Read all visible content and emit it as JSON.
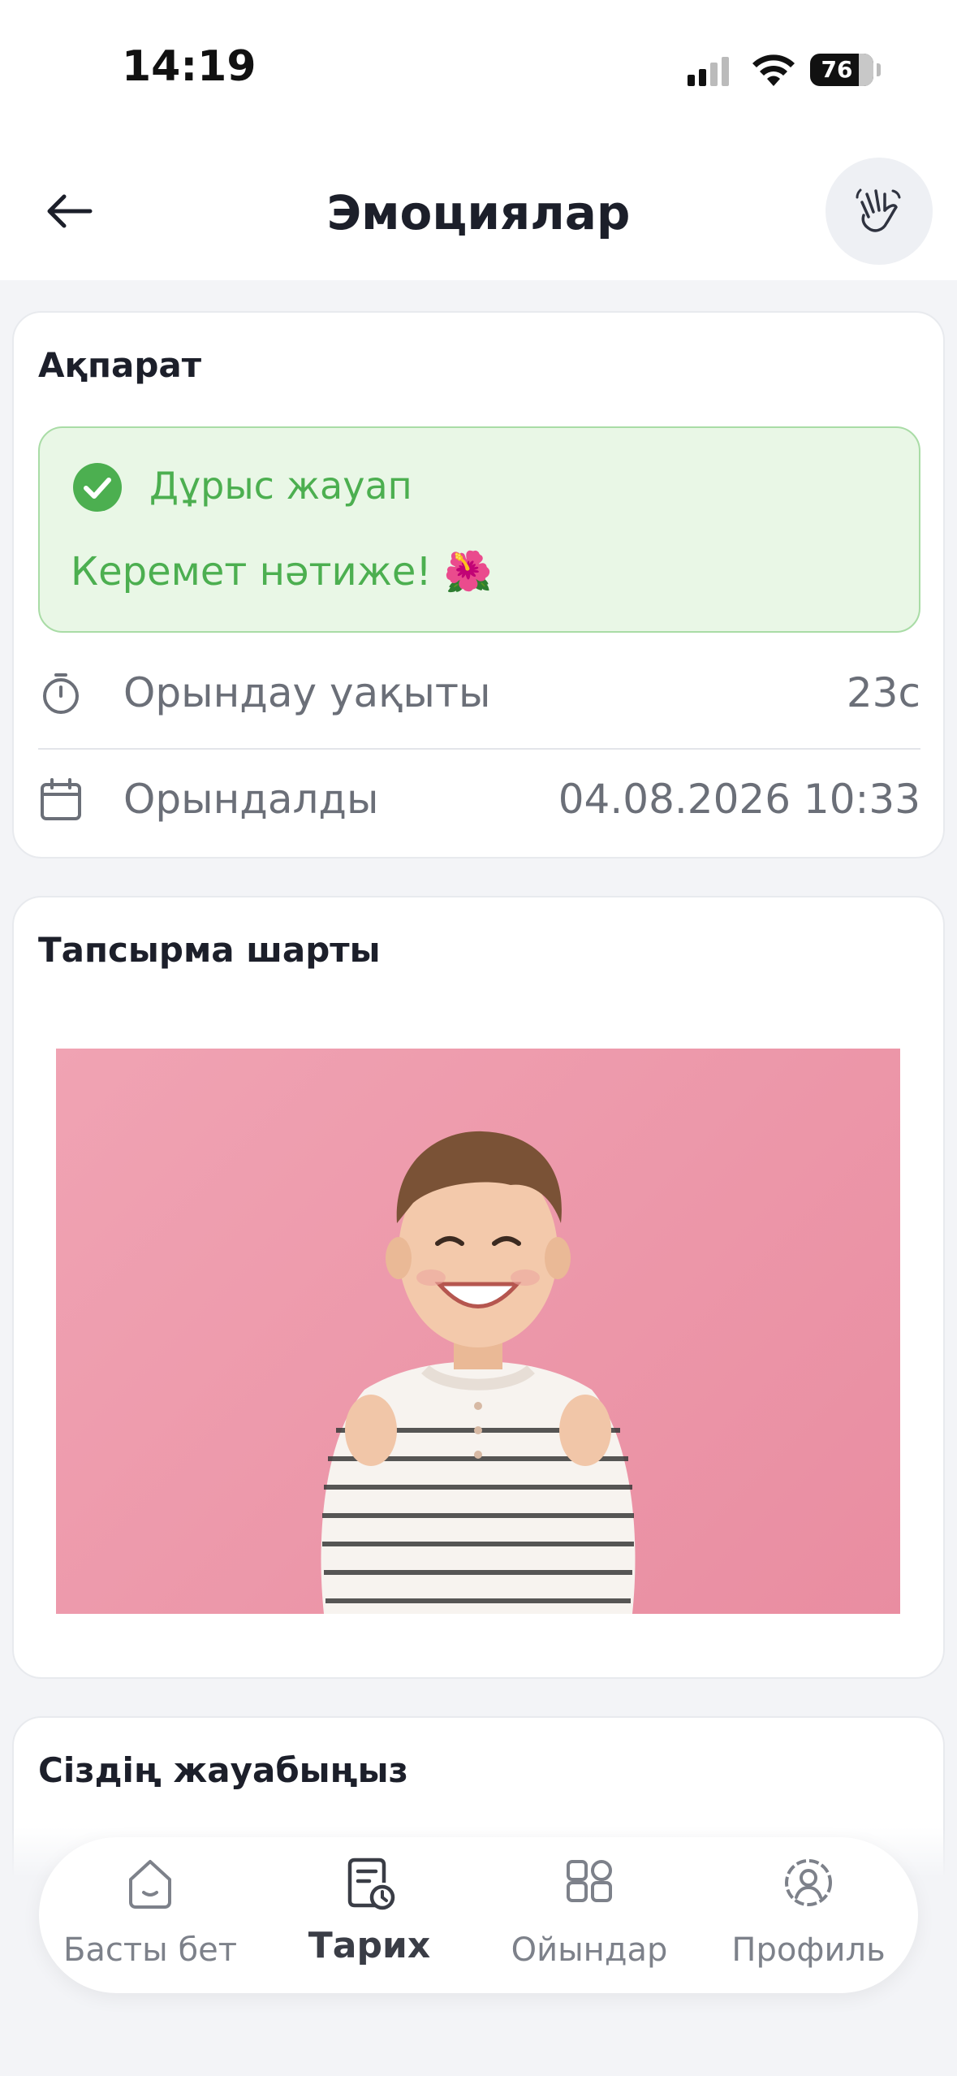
{
  "status_bar": {
    "time": "14:19",
    "battery": "76"
  },
  "header": {
    "title": "Эмоциялар",
    "back_icon": "arrow-left-icon",
    "action_icon": "waving-hand-icon"
  },
  "info_card": {
    "title": "Ақпарат",
    "result": {
      "title": "Дұрыс жауап",
      "message": "Керемет нәтиже! 🌺",
      "color": "#4caf50",
      "background": "#e9f7e6"
    },
    "duration": {
      "label": "Орындау уақыты",
      "value": "23с",
      "icon": "stopwatch-icon"
    },
    "completed": {
      "label": "Орындалды",
      "value": "04.08.2026 10:33",
      "icon": "calendar-icon"
    }
  },
  "task_card": {
    "title": "Тапсырма шарты",
    "image_subject": "smiling-boy-photo"
  },
  "answer_card": {
    "title": "Сіздің жауабыңыз"
  },
  "bottom_nav": {
    "items": [
      {
        "label": "Басты бет",
        "icon": "home-icon",
        "active": false
      },
      {
        "label": "Тарих",
        "icon": "history-icon",
        "active": true
      },
      {
        "label": "Ойындар",
        "icon": "games-grid-icon",
        "active": false
      },
      {
        "label": "Профиль",
        "icon": "profile-icon",
        "active": false
      }
    ]
  }
}
